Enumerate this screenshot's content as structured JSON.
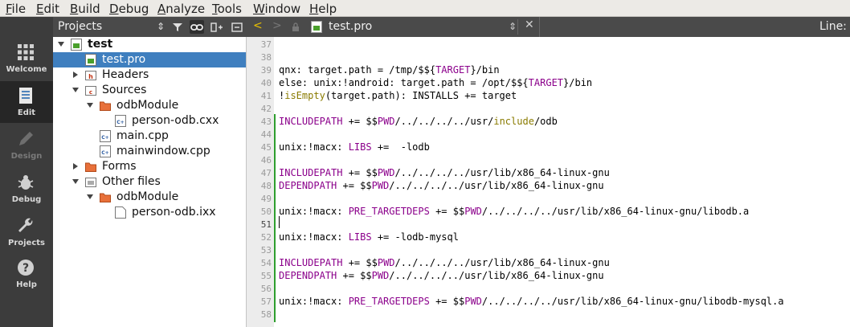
{
  "menubar": {
    "items": [
      {
        "first": "F",
        "rest": "ile"
      },
      {
        "first": "E",
        "rest": "dit"
      },
      {
        "first": "B",
        "rest": "uild"
      },
      {
        "first": "D",
        "rest": "ebug"
      },
      {
        "first": "A",
        "rest": "nalyze"
      },
      {
        "first": "T",
        "rest": "ools"
      },
      {
        "first": "W",
        "rest": "indow"
      },
      {
        "first": "H",
        "rest": "elp"
      }
    ]
  },
  "modes": [
    {
      "label": "Welcome",
      "icon": "grid-icon",
      "state": "normal"
    },
    {
      "label": "Edit",
      "icon": "document-icon",
      "state": "active"
    },
    {
      "label": "Design",
      "icon": "pencil-icon",
      "state": "disabled"
    },
    {
      "label": "Debug",
      "icon": "bug-icon",
      "state": "normal"
    },
    {
      "label": "Projects",
      "icon": "wrench-icon",
      "state": "normal"
    },
    {
      "label": "Help",
      "icon": "question-icon",
      "state": "normal"
    }
  ],
  "projects": {
    "title": "Projects",
    "tree": [
      {
        "label": "test",
        "bold": true
      },
      {
        "label": "test.pro",
        "selected": true
      },
      {
        "label": "Headers"
      },
      {
        "label": "Sources"
      },
      {
        "label": "odbModule"
      },
      {
        "label": "person-odb.cxx"
      },
      {
        "label": "main.cpp"
      },
      {
        "label": "mainwindow.cpp"
      },
      {
        "label": "Forms"
      },
      {
        "label": "Other files"
      },
      {
        "label": "odbModule"
      },
      {
        "label": "person-odb.ixx"
      }
    ]
  },
  "editor": {
    "filename": "test.pro",
    "line_label": "Line:",
    "line_numbers": [
      "37",
      "38",
      "39",
      "40",
      "41",
      "42",
      "43",
      "44",
      "45",
      "46",
      "47",
      "48",
      "49",
      "50",
      "51",
      "52",
      "53",
      "54",
      "55",
      "56",
      "57",
      "58"
    ],
    "current_line": "51",
    "lines": [
      [],
      [],
      [
        {
          "t": "qnx: target.path = /tmp/$${"
        },
        {
          "t": "TARGET",
          "c": "var"
        },
        {
          "t": "}/bin"
        }
      ],
      [
        {
          "t": "else: unix:!android: target.path = /opt/$${"
        },
        {
          "t": "TARGET",
          "c": "var"
        },
        {
          "t": "}/bin"
        }
      ],
      [
        {
          "t": "!"
        },
        {
          "t": "isEmpty",
          "c": "kw"
        },
        {
          "t": "(target.path): INSTALLS += target"
        }
      ],
      [],
      [
        {
          "t": "INCLUDEPATH",
          "c": "var"
        },
        {
          "t": " += $$"
        },
        {
          "t": "PWD",
          "c": "var"
        },
        {
          "t": "/../../../../usr/"
        },
        {
          "t": "include",
          "c": "kw"
        },
        {
          "t": "/odb"
        }
      ],
      [],
      [
        {
          "t": "unix:!macx: "
        },
        {
          "t": "LIBS",
          "c": "var"
        },
        {
          "t": " +=  -lodb"
        }
      ],
      [],
      [
        {
          "t": "INCLUDEPATH",
          "c": "var"
        },
        {
          "t": " += $$"
        },
        {
          "t": "PWD",
          "c": "var"
        },
        {
          "t": "/../../../../usr/lib/x86_64-linux-gnu"
        }
      ],
      [
        {
          "t": "DEPENDPATH",
          "c": "var"
        },
        {
          "t": " += $$"
        },
        {
          "t": "PWD",
          "c": "var"
        },
        {
          "t": "/../../../../usr/lib/x86_64-linux-gnu"
        }
      ],
      [],
      [
        {
          "t": "unix:!macx: "
        },
        {
          "t": "PRE_TARGETDEPS",
          "c": "var"
        },
        {
          "t": " += $$"
        },
        {
          "t": "PWD",
          "c": "var"
        },
        {
          "t": "/../../../../usr/lib/x86_64-linux-gnu/libodb.a"
        }
      ],
      [],
      [
        {
          "t": "unix:!macx: "
        },
        {
          "t": "LIBS",
          "c": "var"
        },
        {
          "t": " += -lodb-mysql"
        }
      ],
      [],
      [
        {
          "t": "INCLUDEPATH",
          "c": "var"
        },
        {
          "t": " += $$"
        },
        {
          "t": "PWD",
          "c": "var"
        },
        {
          "t": "/../../../../usr/lib/x86_64-linux-gnu"
        }
      ],
      [
        {
          "t": "DEPENDPATH",
          "c": "var"
        },
        {
          "t": " += $$"
        },
        {
          "t": "PWD",
          "c": "var"
        },
        {
          "t": "/../../../../usr/lib/x86_64-linux-gnu"
        }
      ],
      [],
      [
        {
          "t": "unix:!macx: "
        },
        {
          "t": "PRE_TARGETDEPS",
          "c": "var"
        },
        {
          "t": " += $$"
        },
        {
          "t": "PWD",
          "c": "var"
        },
        {
          "t": "/../../../../usr/lib/x86_64-linux-gnu/libodb-mysql.a"
        }
      ],
      []
    ]
  }
}
